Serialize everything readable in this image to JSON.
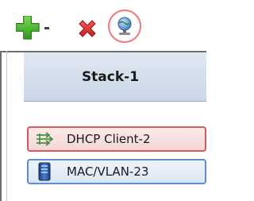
{
  "toolbar": {
    "add_icon": "plus-with-dropdown-icon",
    "delete_icon": "red-x-delete-icon",
    "network_icon": "globe-network-icon",
    "add_color": "#3fae2a",
    "delete_color": "#d62828",
    "highlight_color": "#f07878"
  },
  "stack": {
    "title": "Stack-1",
    "items": [
      {
        "label": "DHCP Client-2",
        "icon": "dhcp-network-arrows-icon",
        "border_color": "#d65a5a"
      },
      {
        "label": "MAC/VLAN-23",
        "icon": "mac-vlan-device-icon",
        "border_color": "#5f8ed0"
      }
    ]
  }
}
